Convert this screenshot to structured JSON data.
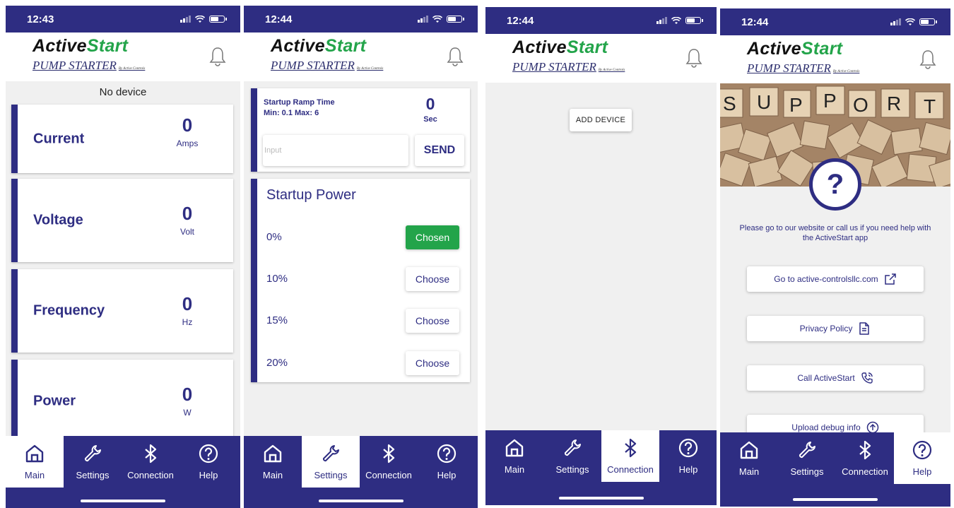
{
  "app": {
    "logo_active": "Active",
    "logo_start": "Start",
    "subtitle": "PUMP STARTER",
    "byline": "By Active Controls"
  },
  "colors": {
    "brand": "#2e2d82",
    "accent_green": "#23a44a",
    "background": "#f0f0f0"
  },
  "nav": {
    "main": "Main",
    "settings": "Settings",
    "connection": "Connection",
    "help": "Help"
  },
  "screens": {
    "main": {
      "time": "12:43",
      "no_device": "No device",
      "metrics": [
        {
          "name": "Current",
          "value": "0",
          "unit": "Amps"
        },
        {
          "name": "Voltage",
          "value": "0",
          "unit": "Volt"
        },
        {
          "name": "Frequency",
          "value": "0",
          "unit": "Hz"
        },
        {
          "name": "Power",
          "value": "0",
          "unit": "W"
        }
      ]
    },
    "settings": {
      "time": "12:44",
      "ramp_title": "Startup Ramp Time",
      "ramp_minmax": "Min: 0.1  Max: 6",
      "ramp_value": "0",
      "ramp_unit": "Sec",
      "input_placeholder": "Input",
      "send_label": "SEND",
      "power_title": "Startup Power",
      "power_options": [
        {
          "pct": "0%",
          "button": "Chosen"
        },
        {
          "pct": "10%",
          "button": "Choose"
        },
        {
          "pct": "15%",
          "button": "Choose"
        },
        {
          "pct": "20%",
          "button": "Choose"
        }
      ]
    },
    "connection": {
      "time": "12:44",
      "add_device": "ADD DEVICE"
    },
    "help": {
      "time": "12:44",
      "image_letters": [
        "S",
        "U",
        "P",
        "P",
        "O",
        "R",
        "T"
      ],
      "help_text": "Please go to our website or call us if you need help with the ActiveStart app",
      "website_button": "Go to active-controlsllc.com",
      "privacy_button": "Privacy Policy",
      "call_button": "Call ActiveStart",
      "upload_button": "Upload debug info"
    }
  }
}
